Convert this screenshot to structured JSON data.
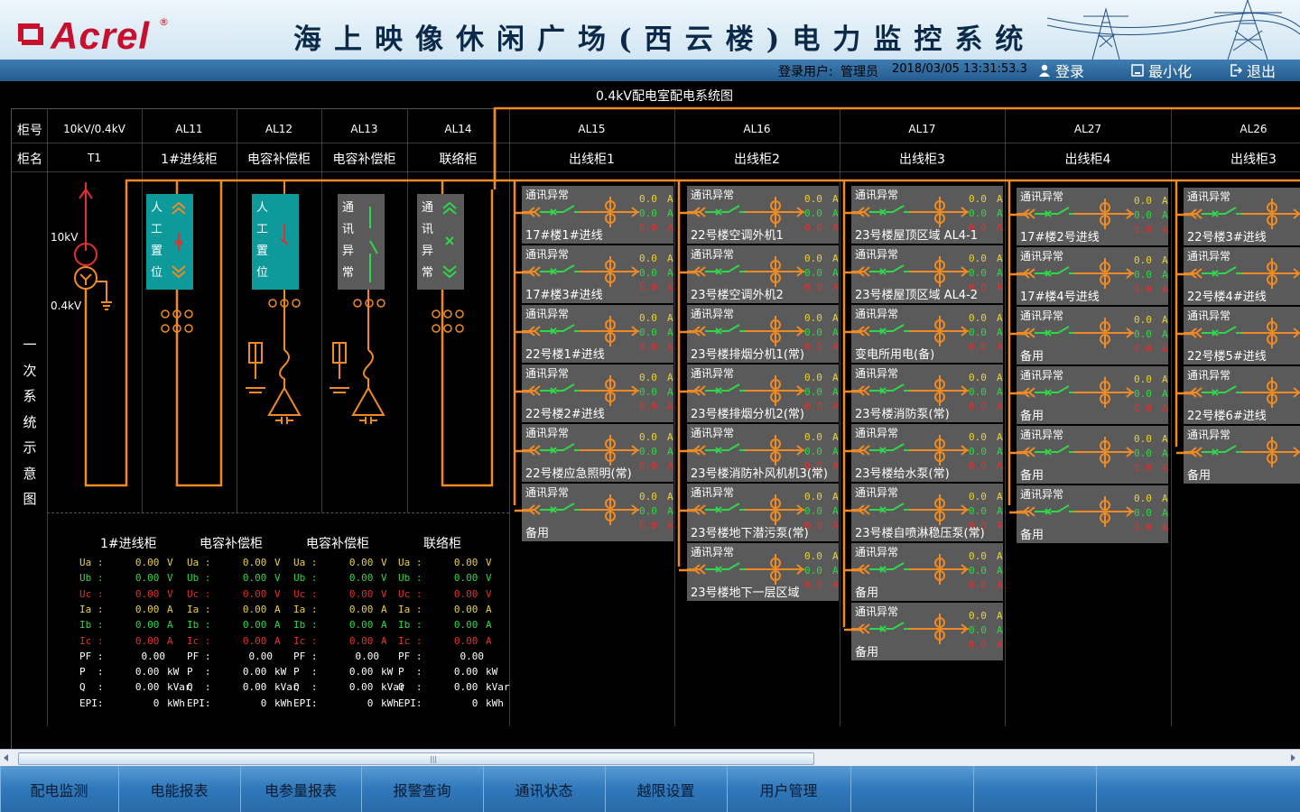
{
  "header": {
    "logo_text": "Acrel",
    "logo_reg": "®",
    "title": "海上映像休闲广场(西云楼)电力监控系统",
    "user_label": "登录用户:",
    "user_name": "管理员",
    "datetime": "2018/03/05 13:31:53.3",
    "login_label": "登录",
    "minimize_label": "最小化",
    "exit_label": "退出"
  },
  "diagram": {
    "title": "0.4kV配电室配电系统图",
    "row_labels": {
      "cabinet_no": "柜号",
      "cabinet_name": "柜名"
    },
    "side_label": [
      "一",
      "次",
      "系",
      "统",
      "示",
      "意",
      "图"
    ],
    "columns": [
      {
        "no": "10kV/0.4kV",
        "name": "T1"
      },
      {
        "no": "AL11",
        "name": "1#进线柜"
      },
      {
        "no": "AL12",
        "name": "电容补偿柜"
      },
      {
        "no": "AL13",
        "name": "电容补偿柜"
      },
      {
        "no": "AL14",
        "name": "联络柜"
      },
      {
        "no": "AL15",
        "name": "出线柜1"
      },
      {
        "no": "AL16",
        "name": "出线柜2"
      },
      {
        "no": "AL17",
        "name": "出线柜3"
      },
      {
        "no": "AL27",
        "name": "出线柜4"
      },
      {
        "no": "AL26",
        "name": "出线柜3"
      }
    ],
    "transformer": {
      "hv": "10kV",
      "lv": "0.4kV"
    },
    "switch_boxes": [
      {
        "chars": [
          "人",
          "工",
          "置",
          "位"
        ]
      },
      {
        "chars": [
          "人",
          "工",
          "置",
          "位"
        ]
      },
      {
        "chars": [
          "通",
          "讯",
          "异",
          "常"
        ]
      },
      {
        "chars": [
          "通",
          "讯",
          "异",
          "常"
        ]
      }
    ]
  },
  "feeders": {
    "comm_status": "通讯异常",
    "value": "0.0",
    "unit": "A",
    "groups": [
      {
        "names": [
          "17#楼1#进线",
          "17#楼3#进线",
          "22号楼1#进线",
          "22号楼2#进线",
          "22号楼应急照明(常)",
          "备用"
        ]
      },
      {
        "names": [
          "22号楼空调外机1",
          "23号楼空调外机2",
          "23号楼排烟分机1(常)",
          "23号楼排烟分机2(常)",
          "23号楼消防补风机机3(常)",
          "23号楼地下潜污泵(常)",
          "23号楼地下一层区域"
        ]
      },
      {
        "names": [
          "23号楼屋顶区域 AL4-1",
          "23号楼屋顶区域 AL4-2",
          "变电所用电(备)",
          "23号楼消防泵(常)",
          "23号楼给水泵(常)",
          "23号楼自喷淋稳压泵(常)",
          "备用",
          "备用"
        ]
      },
      {
        "names": [
          "17#楼2号进线",
          "17#楼4号进线",
          "备用",
          "备用",
          "备用",
          "备用"
        ]
      },
      {
        "names": [
          "22号楼3#进线",
          "22号楼4#进线",
          "22号楼5#进线",
          "22号楼6#进线",
          "备用"
        ]
      }
    ]
  },
  "meters": {
    "panels": [
      {
        "title": "1#进线柜",
        "energy_unit": "kWh"
      },
      {
        "title": "电容补偿柜",
        "energy_unit": "kWh"
      },
      {
        "title": "电容补偿柜",
        "energy_unit": "kWh"
      },
      {
        "title": "联络柜",
        "energy_unit": "kWh"
      }
    ],
    "rows": [
      {
        "label": "Ua :",
        "value": "0.00",
        "unit": "V",
        "color": "#e8d23a"
      },
      {
        "label": "Ub :",
        "value": "0.00",
        "unit": "V",
        "color": "#2fd64a"
      },
      {
        "label": "Uc :",
        "value": "0.00",
        "unit": "V",
        "color": "#e23030"
      },
      {
        "label": "Ia :",
        "value": "0.00",
        "unit": "A",
        "color": "#e8d23a"
      },
      {
        "label": "Ib :",
        "value": "0.00",
        "unit": "A",
        "color": "#2fd64a"
      },
      {
        "label": "Ic :",
        "value": "0.00",
        "unit": "A",
        "color": "#e23030"
      },
      {
        "label": "PF :",
        "value": "0.00",
        "unit": "",
        "color": "#ffffff"
      },
      {
        "label": "P  :",
        "value": "0.00",
        "unit": "kW",
        "color": "#ffffff"
      },
      {
        "label": "Q  :",
        "value": "0.00",
        "unit": "kVar",
        "color": "#ffffff"
      },
      {
        "label": "EPI:",
        "value": "0",
        "unit": "kWh",
        "color": "#ffffff"
      }
    ]
  },
  "nav": {
    "items": [
      "配电监测",
      "电能报表",
      "电参量报表",
      "报警查询",
      "通讯状态",
      "越限设置",
      "用户管理",
      "",
      "",
      ""
    ]
  },
  "colors": {
    "bus": "#f08a24",
    "green": "#2fd64a",
    "red": "#e23030",
    "yellow": "#e8d23a",
    "card": "#5a5a5a",
    "teal": "#0e9a9a"
  }
}
